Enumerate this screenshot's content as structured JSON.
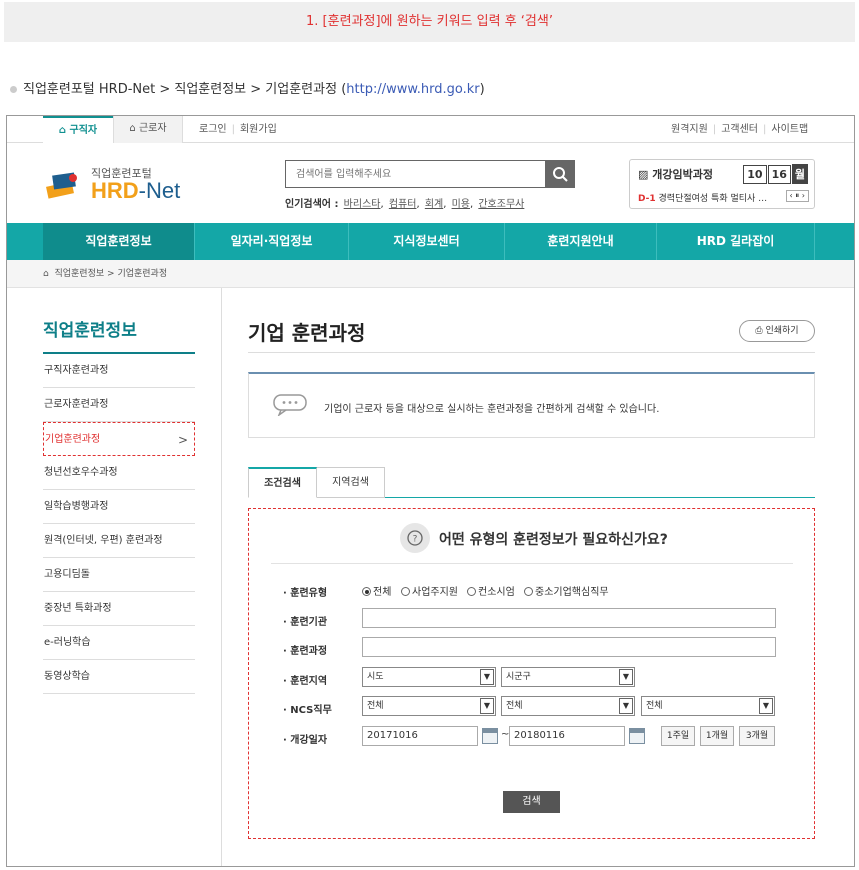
{
  "instruction": "1. [훈련과정]에 원하는 키워드 입력 후 ‘검색’",
  "path": {
    "text": "직업훈련포털 HRD-Net > 직업훈련정보 > 기업훈련과정 (",
    "url": "http://www.hrd.go.kr",
    "close": ")"
  },
  "util": {
    "tab_seeker": "⌂ 구직자",
    "tab_worker": "⌂ 근로자",
    "login": "로그인",
    "join": "회원가입",
    "remote": "원격지원",
    "support": "고객센터",
    "sitemap": "사이트맵"
  },
  "logo": {
    "small": "직업훈련포털",
    "hrd": "HRD",
    "net": "-Net"
  },
  "search": {
    "placeholder": "검색어를 입력해주세요",
    "popular_label": "인기검색어 :",
    "keywords": [
      "바리스타",
      "컴퓨터",
      "회계",
      "미용",
      "간호조무사"
    ]
  },
  "open_course": {
    "title": "개강임박과정",
    "month": "10",
    "day": "16",
    "unit": "월",
    "dday": "D-1",
    "item": "경력단절여성 특화 멀티사 …",
    "controls": "‹ ⏸ ›"
  },
  "gnb": [
    "직업훈련정보",
    "일자리·직업정보",
    "지식정보센터",
    "훈련지원안내",
    "HRD 길라잡이"
  ],
  "breadcrumb": {
    "home": "⌂",
    "l1": "직업훈련정보",
    "sep": ">",
    "l2": "기업훈련과정"
  },
  "lnb": {
    "title": "직업훈련정보",
    "items": [
      "구직자훈련과정",
      "근로자훈련과정",
      "기업훈련과정",
      "청년선호우수과정",
      "일학습병행과정",
      "원격(인터넷, 우편) 훈련과정",
      "고용디딤돌",
      "중장년 특화과정",
      "e-러닝학습",
      "동영상학습"
    ]
  },
  "content": {
    "title": "기업 훈련과정",
    "print": "인쇄하기",
    "desc": "기업이 근로자 등을 대상으로 실시하는 훈련과정을 간편하게 검색할 수 있습니다.",
    "tabs": [
      "조건검색",
      "지역검색"
    ]
  },
  "form": {
    "heading": "어떤 유형의 훈련정보가 필요하신가요?",
    "labels": {
      "type": "· 훈련유형",
      "org": "· 훈련기관",
      "course": "· 훈련과정",
      "region": "· 훈련지역",
      "ncs": "· NCS직무",
      "date": "· 개강일자"
    },
    "types": [
      "전체",
      "사업주지원",
      "컨소시엄",
      "중소기업핵심직무"
    ],
    "region_sido": "시도",
    "region_sigungu": "시군구",
    "ncs": [
      "전체",
      "전체",
      "전체"
    ],
    "date_from": "20171016",
    "date_to": "20180116",
    "tilde": "~",
    "periods": [
      "1주일",
      "1개월",
      "3개월"
    ],
    "search_btn": "검색"
  }
}
